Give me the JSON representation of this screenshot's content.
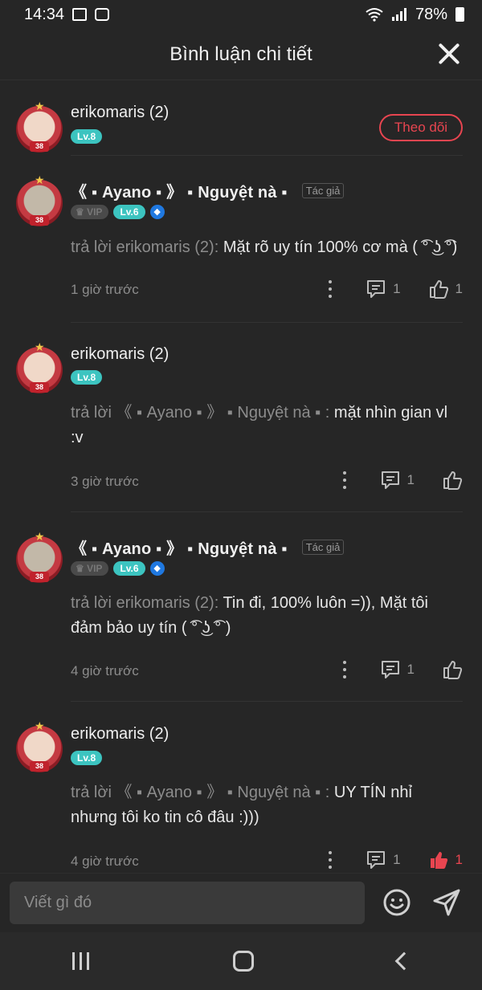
{
  "status_bar": {
    "time": "14:34",
    "battery": "78%"
  },
  "header": {
    "title": "Bình luận chi tiết"
  },
  "main_comment": {
    "username": "erikomaris (2)",
    "level": "Lv.8",
    "follow_label": "Theo dõi"
  },
  "replies": [
    {
      "username": "《 ▪ Ayano ▪ 》 ▪ Nguyệt nà ▪",
      "author_tag": "Tác giả",
      "vip": "VIP",
      "level": "Lv.6",
      "reply_prefix": "trả lời erikomaris (2): ",
      "text": "Mặt rõ uy tín 100% cơ mà ( ͡° ͜ʖ ͡°)",
      "time": "1 giờ trước",
      "comment_count": "1",
      "like_count": "1"
    },
    {
      "username": "erikomaris (2)",
      "level": "Lv.8",
      "reply_prefix": "trả lời 《 ▪ Ayano ▪ 》 ▪ Nguyệt nà ▪ : ",
      "text": "mặt nhìn gian vl :v",
      "time": "3 giờ trước",
      "comment_count": "1",
      "like_count": ""
    },
    {
      "username": "《 ▪ Ayano ▪ 》 ▪ Nguyệt nà ▪",
      "author_tag": "Tác giả",
      "vip": "VIP",
      "level": "Lv.6",
      "reply_prefix": "trả lời erikomaris (2): ",
      "text": "Tin đi, 100% luôn =)), Mặt tôi đảm bảo uy tín ( ͡° ͜ʖ ͡° )",
      "time": "4 giờ trước",
      "comment_count": "1",
      "like_count": ""
    },
    {
      "username": "erikomaris (2)",
      "level": "Lv.8",
      "reply_prefix": "trả lời 《 ▪ Ayano ▪ 》 ▪ Nguyệt nà ▪ : ",
      "text": "UY TÍN nhỉ nhưng tôi ko tin cô đâu :)))",
      "time": "4 giờ trước",
      "comment_count": "1",
      "like_count": "1"
    }
  ],
  "avatar_badge": "38",
  "input": {
    "placeholder": "Viết gì đó"
  },
  "colors": {
    "accent": "#e84550",
    "level_badge": "#3cc4c0",
    "background": "#262626"
  }
}
